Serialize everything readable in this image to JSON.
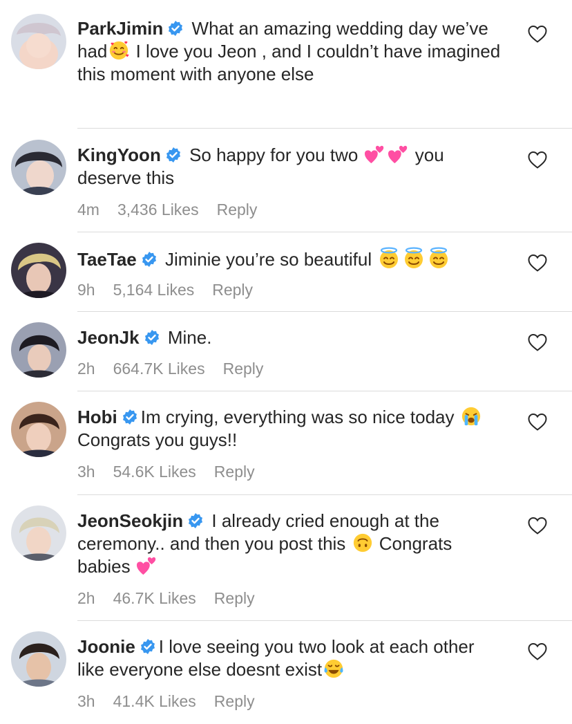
{
  "colors": {
    "text": "#262626",
    "meta": "#8e8e8e",
    "verified": "#3897f0",
    "divider": "#dbdbdb"
  },
  "comments": [
    {
      "username": "ParkJimin",
      "verified": true,
      "text_parts": [
        "What an amazing wedding day we've had",
        "[smiling-face-with-hearts-emoji]",
        " I love you Jeon , and I couldn't have imagined this moment with anyone else"
      ],
      "texts": {
        "a": "What an amazing wedding day we’ve had",
        "b": " I love you Jeon , and I couldn’t have imagined this moment with anyone else"
      },
      "time": "",
      "likes": "",
      "reply": ""
    },
    {
      "username": "KingYoon",
      "verified": true,
      "texts": {
        "a": "So happy for you two ",
        "b": " you deserve this"
      },
      "time": "4m",
      "likes": "3,436 Likes",
      "reply": "Reply"
    },
    {
      "username": "TaeTae",
      "verified": true,
      "texts": {
        "a": "Jiminie you’re so beautiful "
      },
      "time": "9h",
      "likes": "5,164 Likes",
      "reply": "Reply"
    },
    {
      "username": "JeonJk",
      "verified": true,
      "texts": {
        "a": "Mine."
      },
      "time": "2h",
      "likes": "664.7K Likes",
      "reply": "Reply"
    },
    {
      "username": "Hobi",
      "verified": true,
      "texts": {
        "a": "Im crying, everything was so nice today ",
        "b": " Congrats you guys!!"
      },
      "time": "3h",
      "likes": "54.6K Likes",
      "reply": "Reply"
    },
    {
      "username": "JeonSeokjin",
      "verified": true,
      "texts": {
        "a": "I already cried enough at the ceremony.. and then you post this ",
        "b": " Congrats babies "
      },
      "time": "2h",
      "likes": "46.7K Likes",
      "reply": "Reply"
    },
    {
      "username": "Joonie",
      "verified": true,
      "texts": {
        "a": "I love seeing you two look at each other like everyone else doesnt exist"
      },
      "time": "3h",
      "likes": "41.4K Likes",
      "reply": "Reply"
    }
  ]
}
